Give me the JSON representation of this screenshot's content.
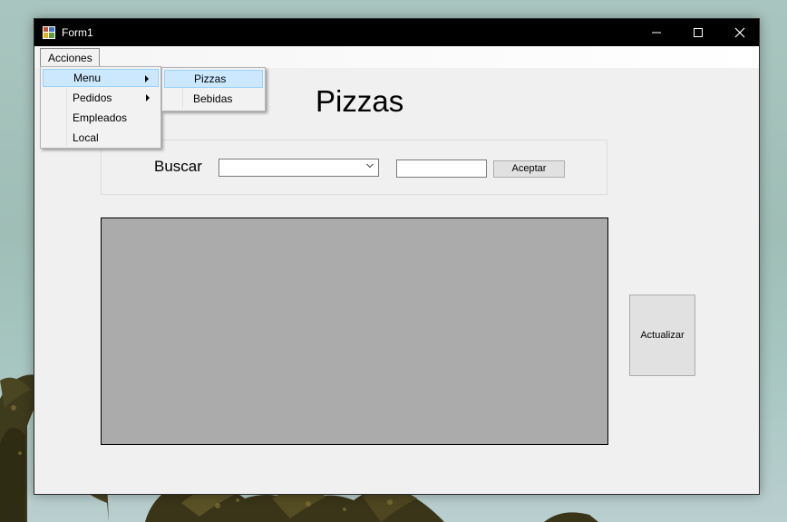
{
  "window": {
    "title": "Form1"
  },
  "menubar": {
    "acciones_label": "Acciones"
  },
  "acciones_menu": {
    "items": [
      {
        "label": "Menu",
        "has_submenu": true,
        "highlighted": true
      },
      {
        "label": "Pedidos",
        "has_submenu": true,
        "highlighted": false
      },
      {
        "label": "Empleados",
        "has_submenu": false,
        "highlighted": false
      },
      {
        "label": "Local",
        "has_submenu": false,
        "highlighted": false
      }
    ]
  },
  "menu_submenu": {
    "items": [
      {
        "label": "Pizzas",
        "highlighted": true
      },
      {
        "label": "Bebidas",
        "highlighted": false
      }
    ]
  },
  "main": {
    "title": "Pizzas",
    "search_label": "Buscar",
    "combo_value": "",
    "text_value": "",
    "accept_label": "Aceptar",
    "refresh_label": "Actualizar"
  },
  "colors": {
    "titlebar": "#000000",
    "form_background": "#f0f0f0",
    "grid_background": "#ababab",
    "menu_highlight": "#cce8ff"
  }
}
